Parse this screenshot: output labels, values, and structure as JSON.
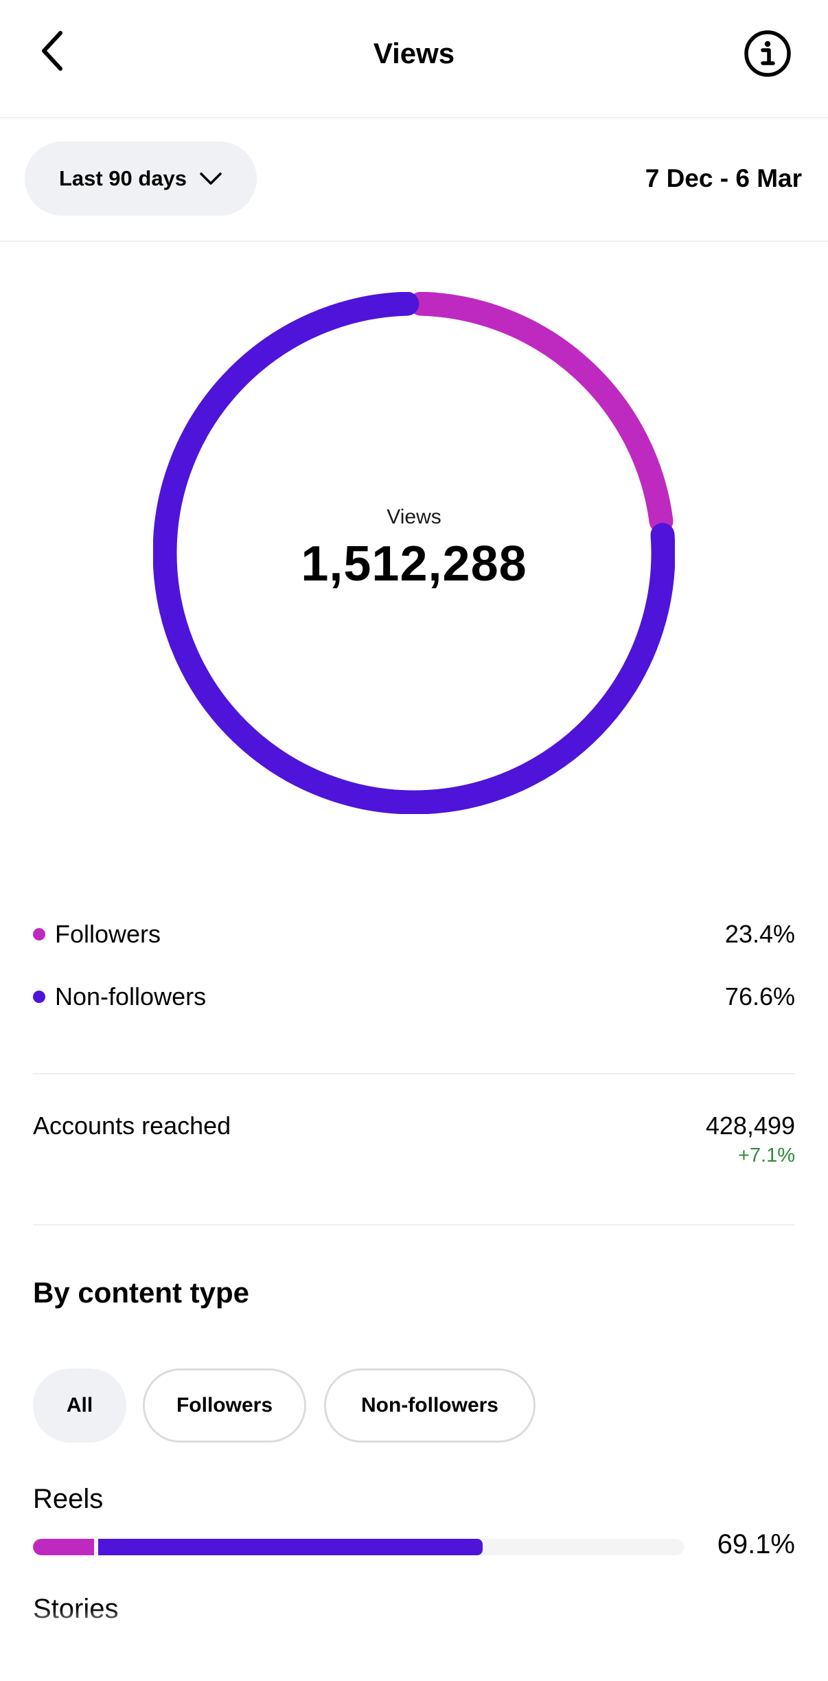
{
  "header": {
    "title": "Views",
    "back_icon": "chevron-left-icon",
    "info_icon": "info-circle-icon"
  },
  "filter": {
    "range_label": "Last 90 days",
    "range_icon": "chevron-down-icon",
    "date_range": "7 Dec - 6 Mar"
  },
  "donut": {
    "center_label": "Views",
    "center_value": "1,512,288",
    "segments": [
      {
        "name": "Followers",
        "fraction": 0.234,
        "color": "#be2ac0"
      },
      {
        "name": "Non-followers",
        "fraction": 0.766,
        "color": "#4e14d9"
      }
    ]
  },
  "legend": [
    {
      "label": "Followers",
      "value": "23.4%",
      "color": "#be2ac0"
    },
    {
      "label": "Non-followers",
      "value": "76.6%",
      "color": "#4e14d9"
    }
  ],
  "reach": {
    "label": "Accounts reached",
    "value": "428,499",
    "change": "+7.1%",
    "change_color": "#2f8a3a"
  },
  "content_type": {
    "title": "By content type",
    "chips": [
      {
        "label": "All",
        "active": true
      },
      {
        "label": "Followers",
        "active": false
      },
      {
        "label": "Non-followers",
        "active": false
      }
    ],
    "rows": [
      {
        "label": "Reels",
        "percent": "69.1%",
        "followers_fraction": 0.094,
        "nonfollowers_fraction": 0.597
      },
      {
        "label": "Stories"
      }
    ]
  },
  "colors": {
    "followers": "#be2ac0",
    "non_followers": "#4e14d9",
    "track": "#f4f4f5"
  }
}
